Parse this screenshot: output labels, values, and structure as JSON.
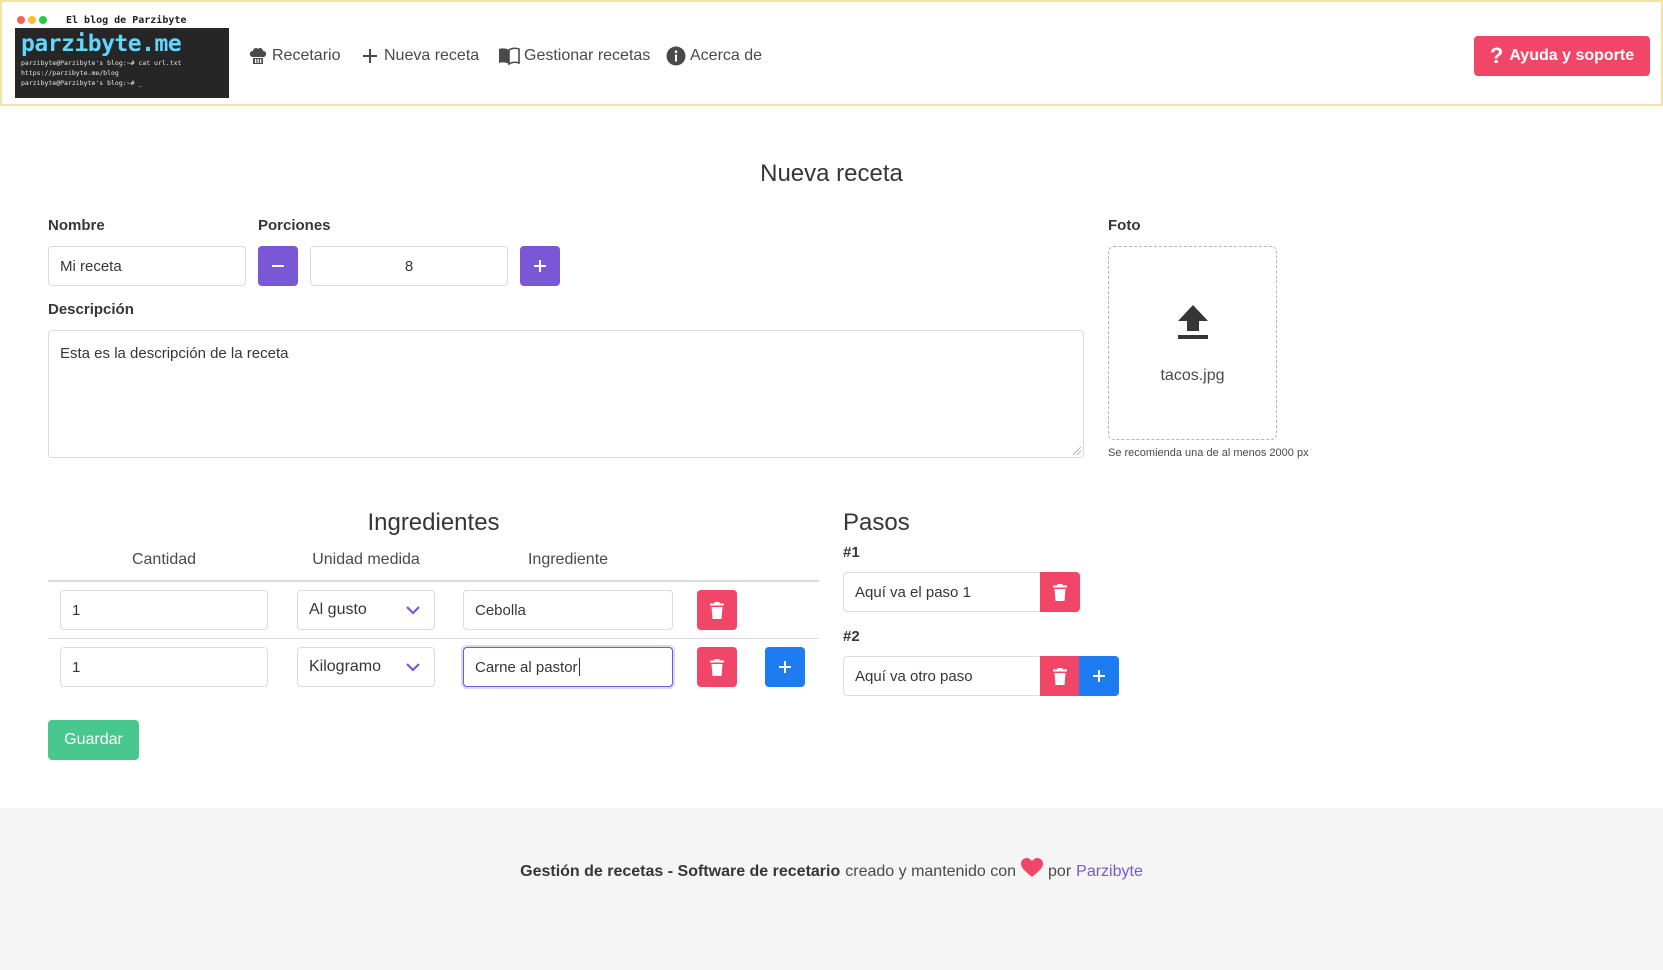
{
  "navbar": {
    "logo": {
      "window_title": "El blog de Parzibyte",
      "brand": "parzibyte.me",
      "terminal_lines": [
        "parzibyte@Parzibyte's blog:~# cat url.txt",
        "https://parzibyte.me/blog",
        "parzibyte@Parzibyte's blog:~# _"
      ]
    },
    "items": [
      {
        "label": "Recetario",
        "icon": "chef-hat-icon"
      },
      {
        "label": "Nueva receta",
        "icon": "plus-icon"
      },
      {
        "label": "Gestionar recetas",
        "icon": "book-open-icon"
      },
      {
        "label": "Acerca de",
        "icon": "info-circle-icon"
      }
    ],
    "help_button": {
      "label": "Ayuda y soporte",
      "icon": "?"
    }
  },
  "form": {
    "title": "Nueva receta",
    "name": {
      "label": "Nombre",
      "value": "Mi receta"
    },
    "portions": {
      "label": "Porciones",
      "value": "8"
    },
    "description": {
      "label": "Descripción",
      "value": "Esta es la descripción de la receta"
    },
    "photo": {
      "label": "Foto",
      "file_name": "tacos.jpg",
      "hint": "Se recomienda una de al menos 2000 px"
    }
  },
  "ingredients": {
    "title": "Ingredientes",
    "headers": [
      "Cantidad",
      "Unidad medida",
      "Ingrediente"
    ],
    "rows": [
      {
        "quantity": "1",
        "unit": "Al gusto",
        "ingredient": "Cebolla"
      },
      {
        "quantity": "1",
        "unit": "Kilogramo",
        "ingredient": "Carne al pastor"
      }
    ]
  },
  "steps": {
    "title": "Pasos",
    "items": [
      {
        "number": "#1",
        "value": "Aquí va el paso 1"
      },
      {
        "number": "#2",
        "value": "Aquí va otro paso"
      }
    ]
  },
  "save_button": "Guardar",
  "footer": {
    "bold_text": "Gestión de recetas - Software de recetario",
    "middle_text": "creado y mantenido con",
    "by_text": "por",
    "link_text": "Parzibyte"
  },
  "colors": {
    "primary": "#7957d5",
    "danger": "#f14668",
    "info": "#1d7cf2",
    "success": "#48c78e"
  }
}
